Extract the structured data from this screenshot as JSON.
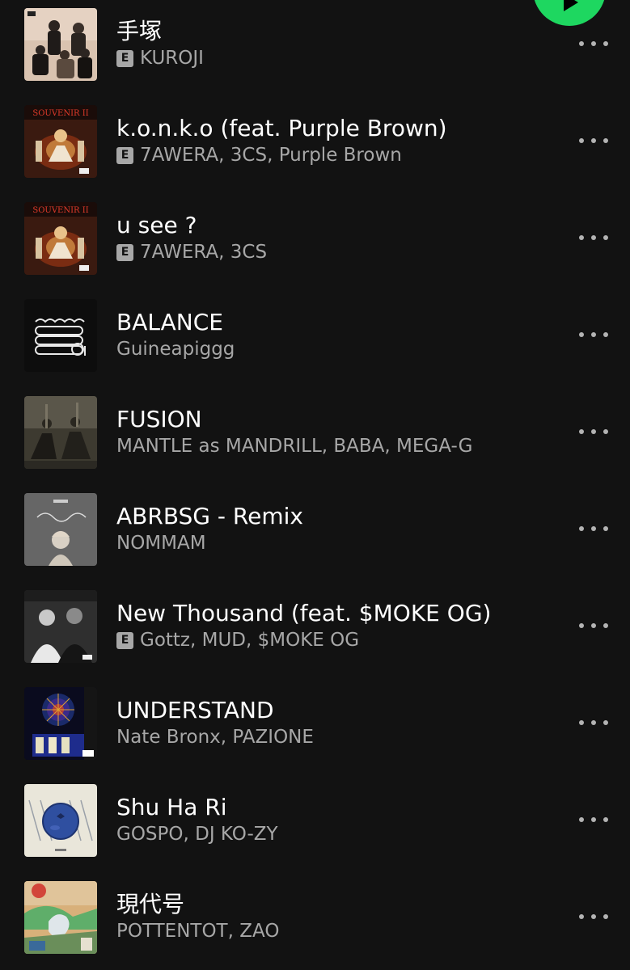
{
  "tracks": [
    {
      "title": "手塚",
      "explicit": true,
      "artists": "KUROJI",
      "cover": "group-photo-cover"
    },
    {
      "title": "k.o.n.k.o (feat. Purple Brown)",
      "explicit": true,
      "artists": "7AWERA, 3CS, Purple Brown",
      "cover": "souvenir-ii-cover",
      "cover_text": "SOUVENIR II"
    },
    {
      "title": "u see ?",
      "explicit": true,
      "artists": "7AWERA, 3CS",
      "cover": "souvenir-ii-cover",
      "cover_text": "SOUVENIR II"
    },
    {
      "title": "BALANCE",
      "explicit": false,
      "artists": "Guineapiggg",
      "cover": "guinea-pig-sketch-cover"
    },
    {
      "title": "FUSION",
      "explicit": false,
      "artists": "MANTLE as MANDRILL, BABA, MEGA-G",
      "cover": "horse-riders-cover"
    },
    {
      "title": "ABRBSG - Remix",
      "explicit": false,
      "artists": "NOMMAM",
      "cover": "portrait-sketch-cover"
    },
    {
      "title": "New Thousand (feat. $MOKE OG)",
      "explicit": true,
      "artists": "Gottz, MUD, $MOKE OG",
      "cover": "duo-photo-cover"
    },
    {
      "title": "UNDERSTAND",
      "explicit": false,
      "artists": "Nate Bronx, PAZIONE",
      "cover": "cathedral-cover"
    },
    {
      "title": "Shu Ha Ri",
      "explicit": false,
      "artists": "GOSPO, DJ KO-ZY",
      "cover": "blueberry-cover"
    },
    {
      "title": "現代号",
      "explicit": false,
      "artists": "POTTENTOT, ZAO",
      "cover": "collage-cover"
    }
  ],
  "explicit_label": "E",
  "colors": {
    "background": "#121212",
    "accent": "#1ed760",
    "secondary_text": "#a7a7a7"
  },
  "icons": {
    "play": "play-icon",
    "more": "more-options-icon"
  }
}
